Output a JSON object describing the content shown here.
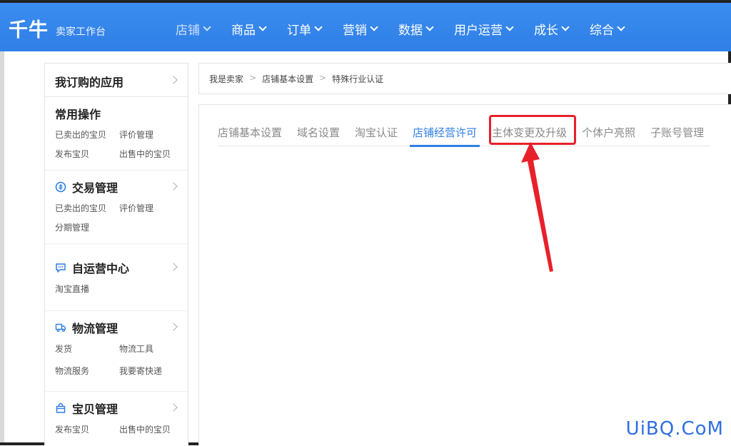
{
  "app": {
    "logo": "千牛",
    "subtitle": "卖家工作台"
  },
  "nav": {
    "items": [
      {
        "label": "店铺"
      },
      {
        "label": "商品"
      },
      {
        "label": "订单"
      },
      {
        "label": "营销"
      },
      {
        "label": "数据"
      },
      {
        "label": "用户运营"
      },
      {
        "label": "成长"
      },
      {
        "label": "综合"
      }
    ]
  },
  "sidebar": {
    "header": "我订购的应用",
    "sections": [
      {
        "title": "常用操作",
        "icon": "none",
        "links": [
          "已卖出的宝贝",
          "评价管理",
          "发布宝贝",
          "出售中的宝贝"
        ]
      },
      {
        "title": "交易管理",
        "icon": "trade-icon",
        "links": [
          "已卖出的宝贝",
          "评价管理",
          "分期管理"
        ]
      },
      {
        "title": "自运营中心",
        "icon": "chat-icon",
        "links": [
          "淘宝直播"
        ]
      },
      {
        "title": "物流管理",
        "icon": "truck-icon",
        "links": [
          "发货",
          "物流工具",
          "物流服务",
          "我要寄快递"
        ]
      },
      {
        "title": "宝贝管理",
        "icon": "bag-icon",
        "links": [
          "发布宝贝",
          "出售中的宝贝"
        ]
      }
    ]
  },
  "breadcrumb": [
    "我是卖家",
    "店铺基本设置",
    "特殊行业认证"
  ],
  "tabs": [
    {
      "label": "店铺基本设置"
    },
    {
      "label": "域名设置"
    },
    {
      "label": "淘宝认证"
    },
    {
      "label": "店铺经营许可"
    },
    {
      "label": "主体变更及升级"
    },
    {
      "label": "个体户亮照"
    },
    {
      "label": "子账号管理"
    }
  ],
  "colors": {
    "brand": "#2f7fe6",
    "highlight": "#e8202a"
  },
  "watermark": "UiBQ.CoM"
}
